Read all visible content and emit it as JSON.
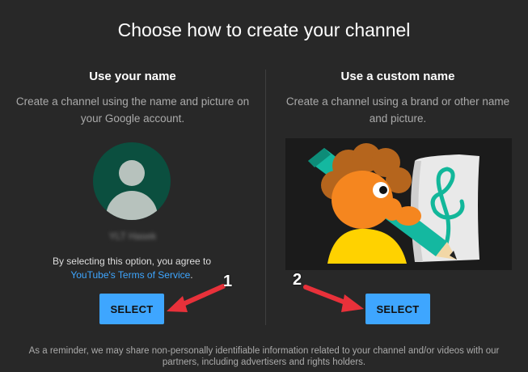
{
  "page": {
    "title": "Choose how to create your channel",
    "footer": "As a reminder, we may share non-personally identifiable information related to your channel and/or videos with our partners, including advertisers and rights holders."
  },
  "left": {
    "heading": "Use your name",
    "description": "Create a channel using the name and picture on your Google account.",
    "blurred_name": "YLT Hasek",
    "agree_text": "By selecting this option, you agree to",
    "tos_link": "YouTube's Terms of Service",
    "tos_suffix": ".",
    "button": "SELECT"
  },
  "right": {
    "heading": "Use a custom name",
    "description": "Create a channel using a brand or other name and picture.",
    "button": "SELECT"
  },
  "annotations": {
    "marker_1": "1",
    "marker_2": "2",
    "arrow_color": "#e8313a"
  },
  "colors": {
    "accent": "#3ea6ff",
    "background": "#282828",
    "avatar_bg": "#0b4f3f"
  }
}
